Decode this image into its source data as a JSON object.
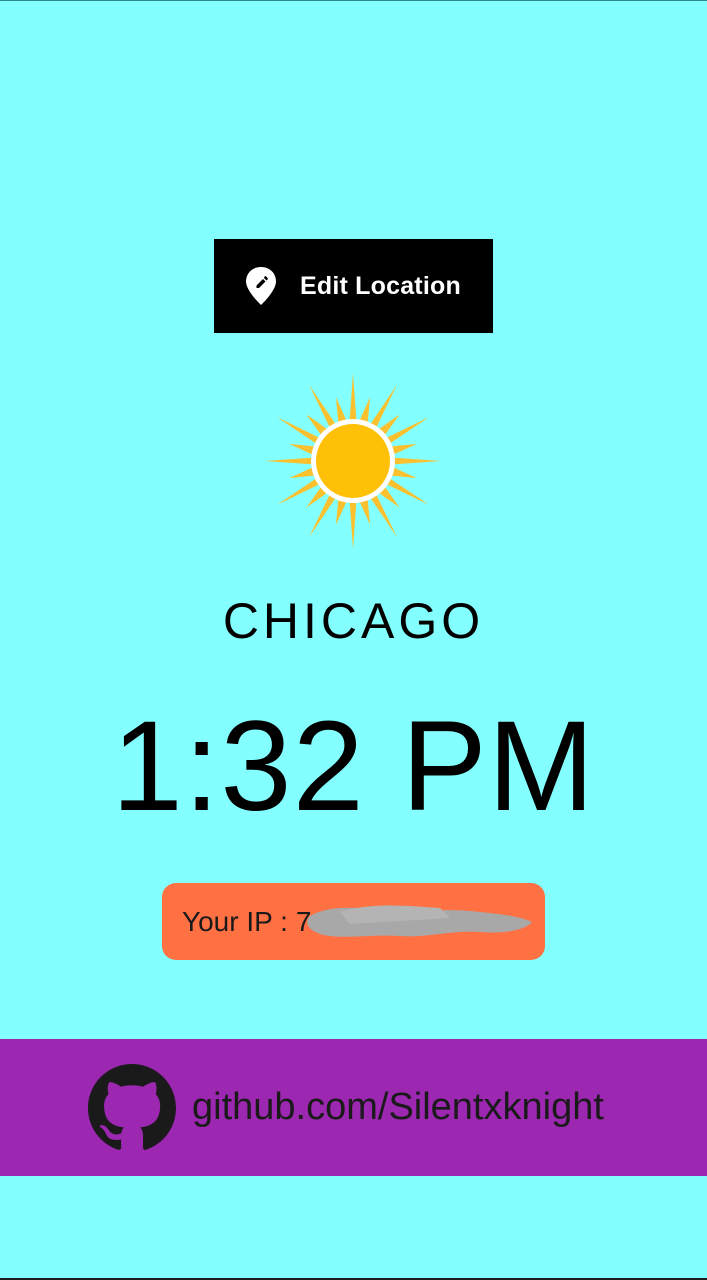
{
  "edit_location": {
    "label": "Edit Location",
    "icon": "location-edit-icon"
  },
  "weather": {
    "icon": "sun-icon"
  },
  "city": "CHICAGO",
  "time": "1:32 PM",
  "ip": {
    "label": "Your IP :",
    "value": "7"
  },
  "footer": {
    "icon": "github-icon",
    "link": "github.com/Silentxknight"
  },
  "colors": {
    "background": "#84ffff",
    "edit_button": "#000000",
    "ip_pill": "#ff7043",
    "footer": "#9c27b0",
    "sun": "#ffc107"
  }
}
